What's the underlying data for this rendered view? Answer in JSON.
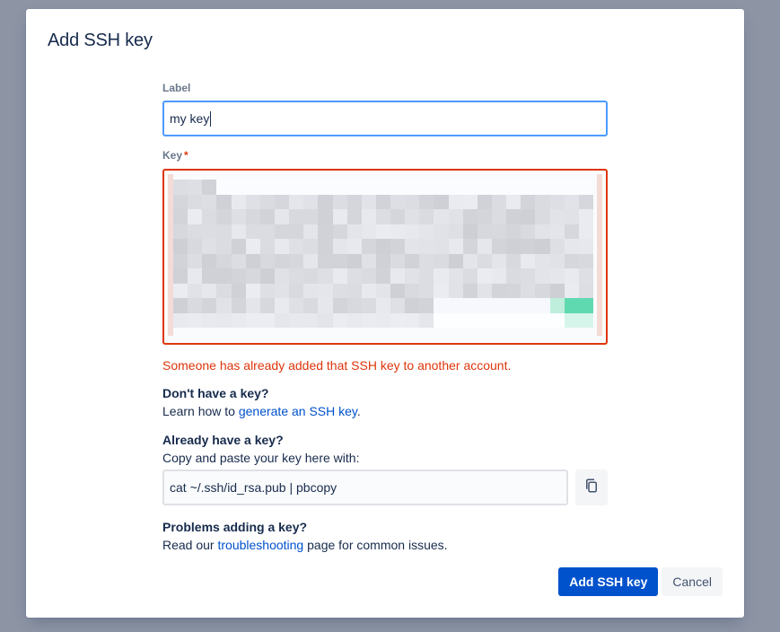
{
  "modal": {
    "title": "Add SSH key"
  },
  "label_field": {
    "label": "Label",
    "value": "my key"
  },
  "key_field": {
    "label": "Key",
    "required_marker": "*",
    "error": "Someone has already added that SSH key to another account."
  },
  "no_key": {
    "title": "Don't have a key?",
    "text_prefix": "Learn how to ",
    "link": "generate an SSH key",
    "text_suffix": "."
  },
  "have_key": {
    "title": "Already have a key?",
    "text": "Copy and paste your key here with:",
    "command": "cat ~/.ssh/id_rsa.pub | pbcopy",
    "copy_icon": "copy-icon"
  },
  "problems": {
    "title": "Problems adding a key?",
    "text_prefix": "Read our ",
    "link": "troubleshooting",
    "text_suffix": " page for common issues."
  },
  "footer": {
    "primary_label": "Add SSH key",
    "cancel_label": "Cancel"
  },
  "colors": {
    "primary": "#0052cc",
    "error": "#de350b",
    "focus_border": "#4c9aff",
    "overlay": "#8d95a5"
  }
}
